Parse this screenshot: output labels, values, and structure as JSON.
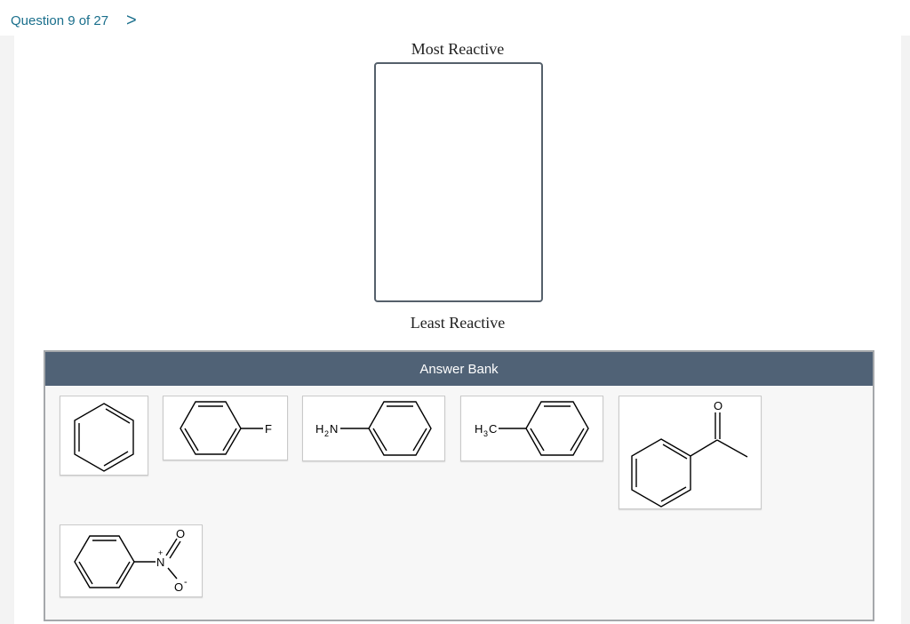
{
  "header": {
    "question_label": "Question 9 of 27",
    "next_label": ">"
  },
  "ranking": {
    "top_label": "Most Reactive",
    "bottom_label": "Least Reactive"
  },
  "answer_bank": {
    "title": "Answer Bank",
    "items": [
      {
        "name": "benzene",
        "labels": []
      },
      {
        "name": "fluorobenzene",
        "labels": [
          "F"
        ]
      },
      {
        "name": "aniline",
        "labels": [
          "H",
          "2",
          "N"
        ]
      },
      {
        "name": "toluene",
        "labels": [
          "H",
          "3",
          "C"
        ]
      },
      {
        "name": "acetophenone",
        "labels": [
          "O"
        ]
      },
      {
        "name": "nitrobenzene",
        "labels": [
          "N",
          "+",
          "O",
          "O",
          "-"
        ]
      }
    ]
  }
}
